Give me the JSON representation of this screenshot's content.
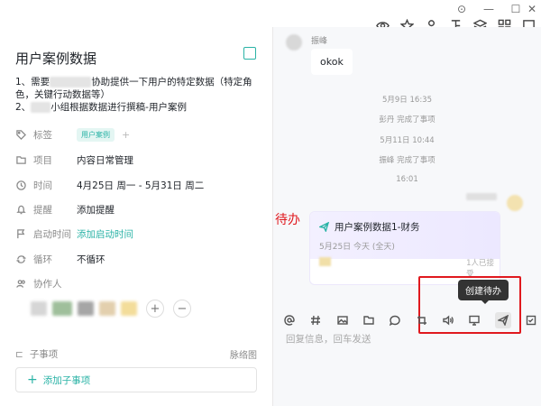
{
  "task": {
    "title": "用户案例数据",
    "desc_line1_a": "1、需要",
    "desc_line1_b": "协助提供一下用户的特定数据（特定角",
    "desc_line2": "色，关键行动数据等）",
    "desc_line3_a": "2、",
    "desc_line3_b": "小组根据数据进行撰稿-用户案例"
  },
  "fields": {
    "tags": {
      "label": "标签",
      "tag": "用户案例",
      "add": "+"
    },
    "project": {
      "label": "项目",
      "value": "内容日常管理"
    },
    "time": {
      "label": "时间",
      "value": "4月25日 周一 - 5月31日 周二"
    },
    "remind": {
      "label": "提醒",
      "value": "添加提醒"
    },
    "start": {
      "label": "启动时间",
      "value": "添加启动时间"
    },
    "repeat": {
      "label": "循环",
      "value": "不循环"
    },
    "collab": {
      "label": "协作人"
    }
  },
  "subtasks": {
    "label": "子事项",
    "mindmap": "脉络图",
    "add": "添加子事项"
  },
  "chat": {
    "sender": "振峰",
    "bubble": "okok",
    "notes": [
      "5月9日 16:35",
      "彭丹 完成了事项",
      "5月11日 10:44",
      "振峰 完成了事项",
      "16:01"
    ],
    "card_title": "用户案例数据1-财务",
    "card_date": "5月25日 今天 (全天)",
    "card_status": "1人已接受"
  },
  "annotation": {
    "label": "待办",
    "tooltip": "创建待办"
  },
  "reply": {
    "placeholder": "回复信息，回车发送"
  },
  "colors": {
    "accent": "#2ab3a6",
    "annotation": "#e0191e"
  }
}
